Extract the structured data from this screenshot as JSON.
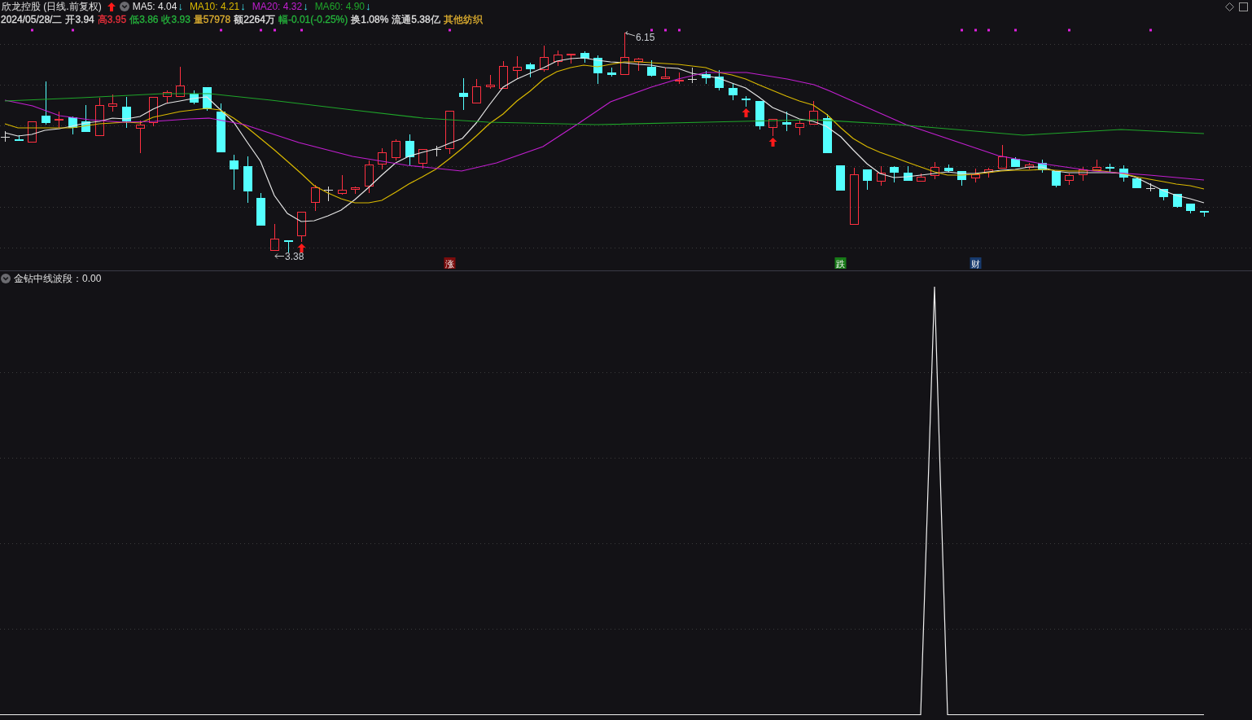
{
  "header": {
    "title": "欣龙控股 (日线.前复权)",
    "moving_averages": [
      {
        "label": "MA5: 4.04",
        "color": "#e6e6e6",
        "arrow": "↓"
      },
      {
        "label": "MA10: 4.21",
        "color": "#d9b800",
        "arrow": "↓"
      },
      {
        "label": "MA20: 4.32",
        "color": "#c21fd0",
        "arrow": "↓"
      },
      {
        "label": "MA60: 4.90",
        "color": "#1fa52a",
        "arrow": "↓"
      }
    ],
    "quote": [
      {
        "text": "2024/05/28/二",
        "color": "#e0e0e0"
      },
      {
        "text": "开3.94",
        "color": "#e0e0e0"
      },
      {
        "text": "高3.95",
        "color": "#f0303c"
      },
      {
        "text": "低3.86",
        "color": "#25b43c"
      },
      {
        "text": "收3.93",
        "color": "#25b43c"
      },
      {
        "text": "量57978",
        "color": "#e0b030"
      },
      {
        "text": "额2264万",
        "color": "#e0e0e0"
      },
      {
        "text": "幅-0.01(-0.25%)",
        "color": "#25b43c"
      },
      {
        "text": "换1.08%",
        "color": "#e0e0e0"
      },
      {
        "text": "流通5.38亿",
        "color": "#e0e0e0"
      },
      {
        "text": "其他纺织",
        "color": "#e0b030"
      }
    ]
  },
  "price_chart": {
    "high_label": "6.15",
    "low_label": "3.38",
    "event_tags": [
      {
        "label": "涨",
        "color": "#7a0c0c"
      },
      {
        "label": "跌",
        "color": "#177a17"
      },
      {
        "label": "财",
        "color": "#173a6e"
      }
    ]
  },
  "indicator": {
    "title": "金钻中线波段：0.00"
  }
}
